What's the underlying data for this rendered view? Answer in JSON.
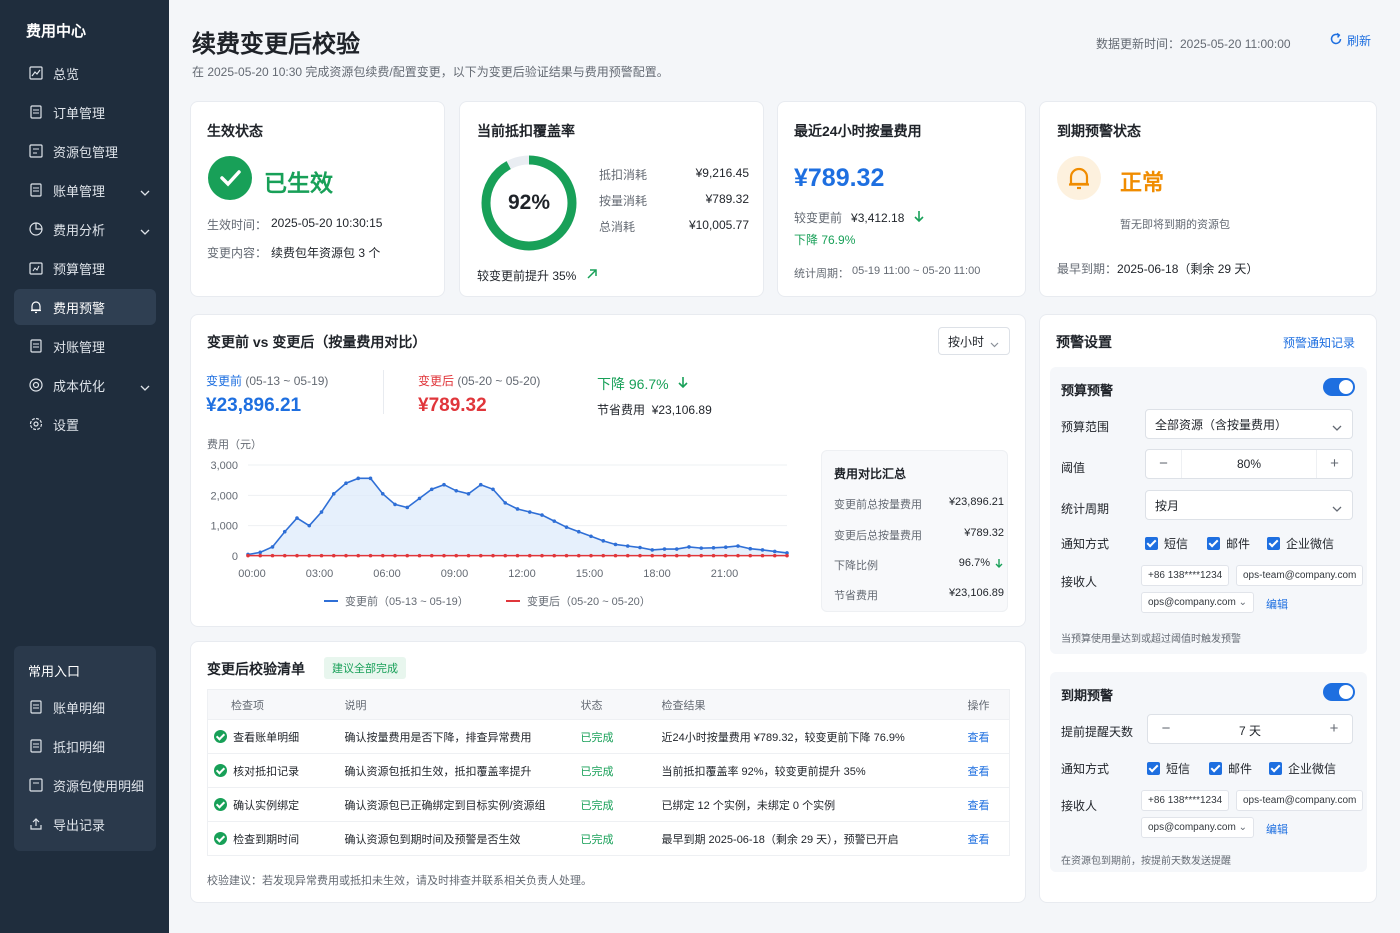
{
  "sidebar": {
    "title": "费用中心",
    "items": [
      {
        "label": "总览"
      },
      {
        "label": "订单管理"
      },
      {
        "label": "资源包管理"
      },
      {
        "label": "账单管理"
      },
      {
        "label": "费用分析"
      },
      {
        "label": "预算管理"
      },
      {
        "label": "费用预警"
      },
      {
        "label": "对账管理"
      },
      {
        "label": "成本优化"
      },
      {
        "label": "设置"
      }
    ],
    "common_title": "常用入口",
    "common": [
      {
        "label": "账单明细"
      },
      {
        "label": "抵扣明细"
      },
      {
        "label": "资源包使用明细"
      },
      {
        "label": "导出记录"
      }
    ]
  },
  "header": {
    "title": "续费变更后校验",
    "subtitle": "在 2025-05-20 10:30 完成资源包续费/配置变更，以下为变更后验证结果与费用预警配置。",
    "update": "数据更新时间：2025-05-20 11:00:00",
    "refresh": "刷新"
  },
  "status": {
    "title": "生效状态",
    "value": "已生效",
    "time_label": "生效时间：",
    "time": "2025-05-20 10:30:15",
    "content_label": "变更内容：",
    "content": "续费包年资源包  3 个"
  },
  "coverage": {
    "title": "当前抵扣覆盖率",
    "percent": "92%",
    "ratio": 0.92,
    "rows": [
      {
        "label": "抵扣消耗",
        "value": "¥9,216.45"
      },
      {
        "label": "按量消耗",
        "value": "¥789.32"
      },
      {
        "label": "总消耗",
        "value": "¥10,005.77"
      }
    ],
    "foot": "较变更前提升  35%"
  },
  "cost24": {
    "title": "最近24小时按量费用",
    "value": "¥789.32",
    "before_label": "较变更前",
    "before": "¥3,412.18",
    "drop": "下降  76.9%",
    "period_label": "统计周期：",
    "period": "05-19 11:00 ~ 05-20 11:00"
  },
  "expire": {
    "title": "到期预警状态",
    "value": "正常",
    "desc": "暂无即将到期的资源包",
    "earliest_label": "最早到期：",
    "earliest": "2025-06-18（剩余 29 天）"
  },
  "compare": {
    "title": "变更前 vs 变更后（按量费用对比）",
    "select": "按小时",
    "before_tag": "变更前",
    "before_range": "(05-13 ~ 05-19)",
    "before_value": "¥23,896.21",
    "after_tag": "变更后",
    "after_range": "(05-20 ~ 05-20)",
    "after_value": "¥789.32",
    "drop": "下降  96.7%",
    "save_label": "节省费用",
    "save": "¥23,106.89",
    "summary": {
      "title": "费用对比汇总",
      "rows": [
        {
          "label": "变更前总按量费用",
          "value": "¥23,896.21"
        },
        {
          "label": "变更后总按量费用",
          "value": "¥789.32"
        },
        {
          "label": "下降比例",
          "value": "96.7%"
        },
        {
          "label": "节省费用",
          "value": "¥23,106.89"
        }
      ]
    }
  },
  "chart_data": {
    "type": "line",
    "ylabel": "费用（元）",
    "ylim": [
      0,
      3000
    ],
    "yticks": [
      "0",
      "1,000",
      "2,000",
      "3,000"
    ],
    "xticks": [
      "00:00",
      "03:00",
      "06:00",
      "09:00",
      "12:00",
      "15:00",
      "18:00",
      "21:00"
    ],
    "series": [
      {
        "name": "变更前（05-13 ~ 05-19）",
        "color": "#2f6fd6",
        "values": [
          50,
          120,
          300,
          800,
          1250,
          1000,
          1450,
          2050,
          2400,
          2560,
          2560,
          2050,
          1700,
          1600,
          1900,
          2200,
          2350,
          2150,
          2050,
          2350,
          2200,
          1750,
          1550,
          1450,
          1350,
          1150,
          950,
          800,
          650,
          500,
          380,
          330,
          280,
          200,
          230,
          230,
          300,
          260,
          270,
          290,
          330,
          240,
          200,
          150,
          100
        ]
      },
      {
        "name": "变更后（05-20 ~ 05-20）",
        "color": "#e0363b",
        "values": [
          12,
          12,
          12,
          12,
          12,
          12,
          12,
          12,
          12,
          12,
          12,
          12,
          12,
          12,
          12,
          12,
          12,
          12,
          12,
          12,
          12,
          12,
          12,
          12,
          12,
          12,
          12,
          12,
          12,
          12,
          12,
          12,
          12,
          12,
          12,
          12,
          12,
          12,
          12,
          12,
          12,
          12,
          12,
          12,
          12
        ]
      }
    ]
  },
  "checklist": {
    "title": "变更后校验清单",
    "badge": "建议全部完成",
    "headers": [
      "检查项",
      "说明",
      "状态",
      "检查结果",
      "操作"
    ],
    "rows": [
      {
        "item": "查看账单明细",
        "desc": "确认按量费用是否下降，排查异常费用",
        "status": "已完成",
        "result": "近24小时按量费用 ¥789.32，较变更前下降 76.9%",
        "op": "查看"
      },
      {
        "item": "核对抵扣记录",
        "desc": "确认资源包抵扣生效，抵扣覆盖率提升",
        "status": "已完成",
        "result": "当前抵扣覆盖率 92%，较变更前提升 35%",
        "op": "查看"
      },
      {
        "item": "确认实例绑定",
        "desc": "确认资源包已正确绑定到目标实例/资源组",
        "status": "已完成",
        "result": "已绑定  12 个实例，未绑定  0 个实例",
        "op": "查看"
      },
      {
        "item": "检查到期时间",
        "desc": "确认资源包到期时间及预警是否生效",
        "status": "已完成",
        "result": "最早到期  2025-06-18（剩余 29 天），预警已开启",
        "op": "查看"
      }
    ],
    "note": "校验建议：若发现异常费用或抵扣未生效，请及时排查并联系相关负责人处理。"
  },
  "alert": {
    "title": "预警设置",
    "link": "预警通知记录",
    "budget": {
      "title": "预算预警",
      "range_label": "预算范围",
      "range": "全部资源（含按量费用）",
      "threshold_label": "阈值",
      "threshold": "80%",
      "period_label": "统计周期",
      "period": "按月",
      "notify_label": "通知方式",
      "sms": "短信",
      "mail": "邮件",
      "wecom": "企业微信",
      "recv_label": "接收人",
      "phone": "+86 138****1234",
      "email1": "ops-team@company.com",
      "email2": "ops@company.com",
      "edit": "编辑",
      "hint": "当预算使用量达到或超过阈值时触发预警"
    },
    "expiry": {
      "title": "到期预警",
      "days_label": "提前提醒天数",
      "days": "7 天",
      "notify_label": "通知方式",
      "sms": "短信",
      "mail": "邮件",
      "wecom": "企业微信",
      "recv_label": "接收人",
      "phone": "+86 138****1234",
      "email1": "ops-team@company.com",
      "email2": "ops@company.com",
      "edit": "编辑",
      "hint": "在资源包到期前，按提前天数发送提醒"
    }
  }
}
